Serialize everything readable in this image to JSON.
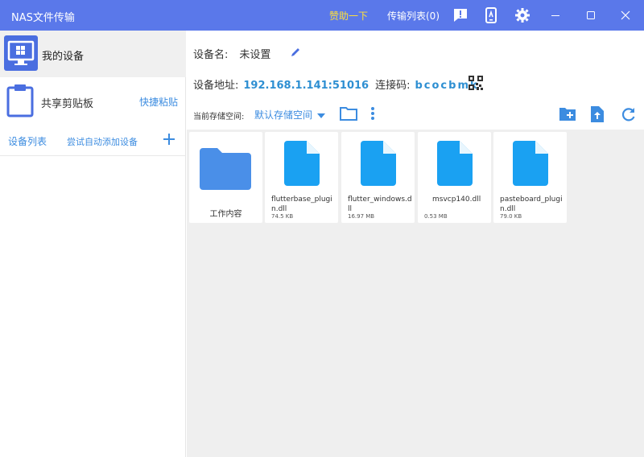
{
  "titlebar": {
    "app_title": "NAS文件传输",
    "sponsor_label": "赞助一下",
    "transfer_label": "传输列表(0)",
    "accent": "#5a78ea",
    "sponsor_color": "#ffe03a"
  },
  "sidebar": {
    "my_device_label": "我的设备",
    "clipboard_label": "共享剪贴板",
    "quick_paste_label": "快捷粘贴",
    "device_list_label": "设备列表",
    "auto_add_label": "尝试自动添加设备"
  },
  "main": {
    "device_name_label": "设备名:",
    "device_name_value": "未设置",
    "device_address_label": "设备地址:",
    "device_address_value": "192.168.1.141:51016",
    "connect_code_label": "连接码:",
    "connect_code_value": "bcocbmk",
    "storage_label": "当前存储空间:",
    "storage_value": "默认存储空间"
  },
  "files": [
    {
      "name": "工作内容",
      "size": "",
      "type": "folder"
    },
    {
      "name": "flutterbase_plugin.dll",
      "size": "74.5 KB",
      "type": "file"
    },
    {
      "name": "flutter_windows.dll",
      "size": "16.97 MB",
      "type": "file"
    },
    {
      "name": "msvcp140.dll",
      "size": "0.53 MB",
      "type": "file"
    },
    {
      "name": "pasteboard_plugin.dll",
      "size": "79.0 KB",
      "type": "file"
    }
  ],
  "icons": {
    "feedback": "feedback-icon",
    "phone": "phone-icon",
    "settings": "gear-icon",
    "minimize": "minimize-icon",
    "maximize": "maximize-icon",
    "close": "close-icon"
  },
  "colors": {
    "link_blue": "#3c8ce0",
    "file_blue": "#1aa1f2",
    "folder_blue": "#4a8fe8"
  }
}
